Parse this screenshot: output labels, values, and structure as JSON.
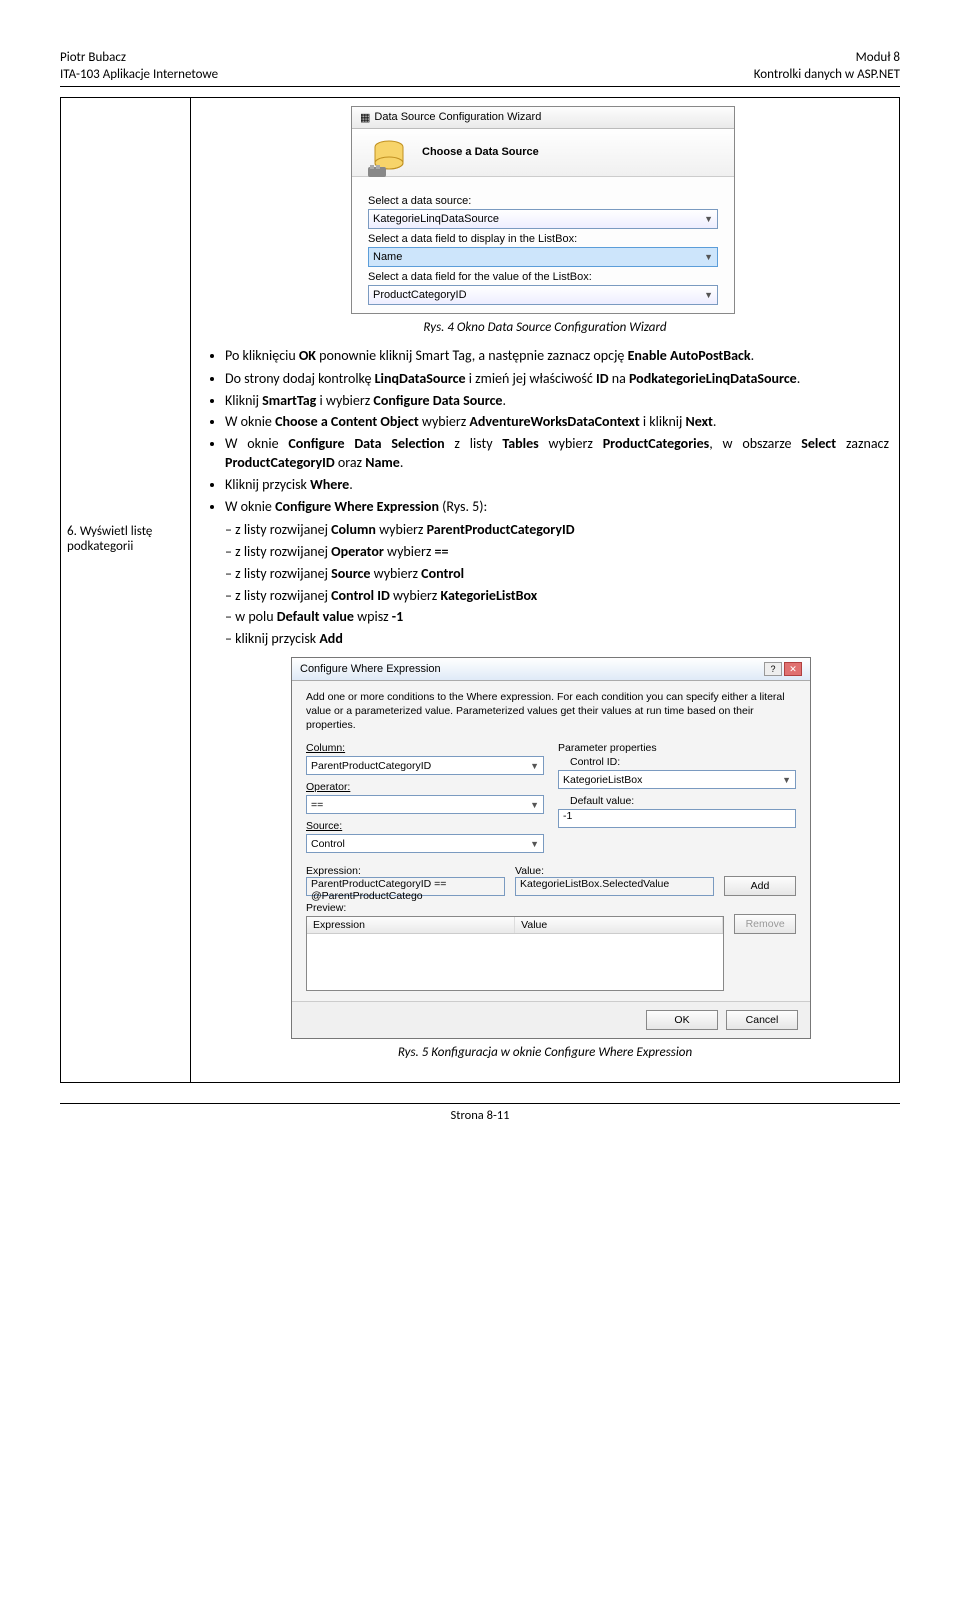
{
  "header": {
    "left1": "Piotr Bubacz",
    "left2": "ITA-103 Aplikacje Internetowe",
    "right1": "Moduł 8",
    "right2": "Kontrolki danych w ASP.NET"
  },
  "wizard1": {
    "windowTitle": "Data Source Configuration Wizard",
    "headline": "Choose a Data Source",
    "label1": "Select a data source:",
    "combo1": "KategorieLinqDataSource",
    "label2": "Select a data field to display in the ListBox:",
    "combo2": "Name",
    "label3": "Select a data field for the value of the ListBox:",
    "combo3": "ProductCategoryID"
  },
  "caption1": "Rys. 4 Okno Data Source Configuration Wizard",
  "step6": {
    "num": "6.",
    "title": "Wyświetl listę podkategorii"
  },
  "text": {
    "p1a": "Po kliknięciu ",
    "p1b": "OK",
    "p1c": " ponownie kliknij Smart Tag, a następnie zaznacz opcję ",
    "p1d": "Enable AutoPostBack",
    "p1e": ".",
    "b1a": "Do strony dodaj kontrolkę ",
    "b1b": "LinqDataSource",
    "b1c": " i zmień jej właściwość ",
    "b1d": "ID",
    "b1e": " na ",
    "b1f": "PodkategorieLinqDataSource",
    "b1g": ".",
    "b2a": "Kliknij ",
    "b2b": "SmartTag",
    "b2c": " i wybierz ",
    "b2d": "Configure Data Source",
    "b2e": ".",
    "b3a": "W  oknie  ",
    "b3b": "Choose  a  Content  Object",
    "b3c": "  wybierz ",
    "b3d": "AdventureWorksDataContext",
    "b3e": " i kliknij ",
    "b3f": "Next",
    "b3g": ".",
    "b4a": "W  oknie  ",
    "b4b": "Configure  Data  Selection",
    "b4c": "  z  listy  ",
    "b4d": "Tables",
    "b4e": "  wybierz ",
    "b4f": "ProductCategories",
    "b4g": ", w obszarze ",
    "b4h": "Select",
    "b4i": " zaznacz ",
    "b4j": "ProductCategoryID",
    "b4k": " oraz ",
    "b4l": "Name",
    "b4m": ".",
    "b5a": "Kliknij przycisk ",
    "b5b": "Where",
    "b5c": ".",
    "b6a": "W oknie ",
    "b6b": "Configure Where Expression",
    "b6c": " (Rys. 5):",
    "d1a": "z listy rozwijanej ",
    "d1b": "Column",
    "d1c": " wybierz ",
    "d1d": "ParentProductCategoryID",
    "d2a": "z listy rozwijanej ",
    "d2b": "Operator",
    "d2c": " wybierz ",
    "d2d": "==",
    "d3a": "z listy rozwijanej ",
    "d3b": "Source",
    "d3c": " wybierz ",
    "d3d": "Control",
    "d4a": "z listy rozwijanej ",
    "d4b": "Control ID",
    "d4c": " wybierz ",
    "d4d": "KategorieListBox",
    "d5a": "w polu ",
    "d5b": "Default value",
    "d5c": " wpisz ",
    "d5d": "-1",
    "d6a": "kliknij przycisk ",
    "d6b": "Add"
  },
  "wizard2": {
    "title": "Configure Where Expression",
    "desc": "Add one or more conditions to the Where expression. For each condition you can specify either a literal value or a parameterized value. Parameterized values get their values at run time based on their properties.",
    "columnLabel": "Column:",
    "column": "ParentProductCategoryID",
    "operatorLabel": "Operator:",
    "operator": "==",
    "sourceLabel": "Source:",
    "source": "Control",
    "paramPropLabel": "Parameter properties",
    "controlIdLabel": "Control ID:",
    "controlId": "KategorieListBox",
    "defaultLabel": "Default value:",
    "default": "-1",
    "expressionLabel": "Expression:",
    "expressionVal": "ParentProductCategoryID == @ParentProductCatego",
    "valueLabel": "Value:",
    "valueVal": "KategorieListBox.SelectedValue",
    "addBtn": "Add",
    "previewLabel": "Preview:",
    "thExpression": "Expression",
    "thValue": "Value",
    "removeBtn": "Remove",
    "okBtn": "OK",
    "cancelBtn": "Cancel"
  },
  "caption2": "Rys. 5 Konfiguracja w oknie Configure Where Expression",
  "footer": "Strona 8-11"
}
